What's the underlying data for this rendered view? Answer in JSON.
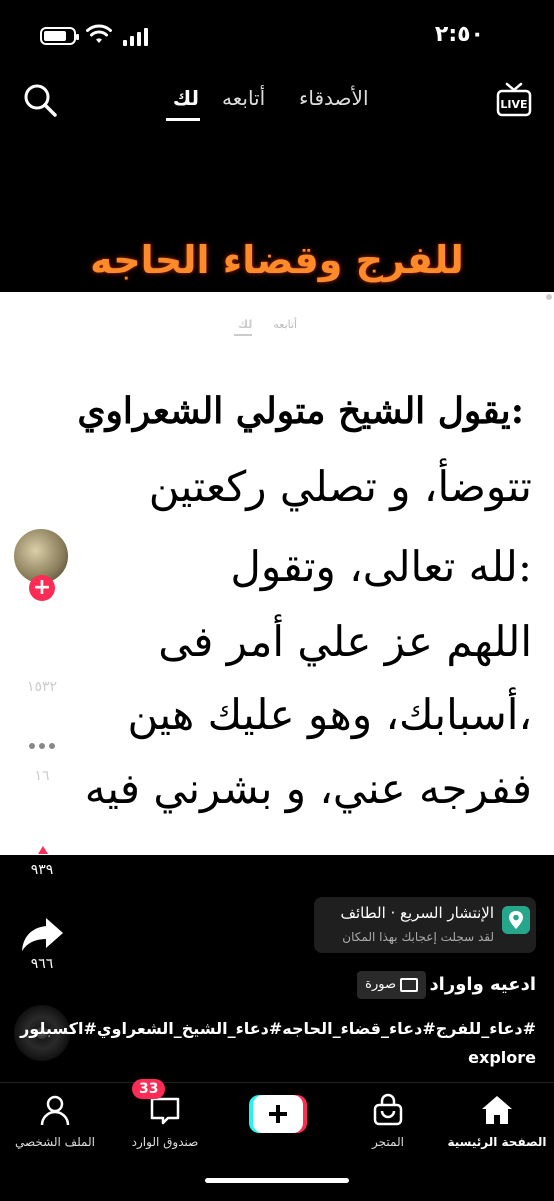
{
  "status": {
    "time": "٢:٥٠"
  },
  "topnav": {
    "tabs": [
      {
        "label": "لك",
        "active": true
      },
      {
        "label": "أتابعه"
      },
      {
        "label": "الأصدقاء"
      }
    ],
    "search_icon": "search-icon",
    "live_label": "LIVE"
  },
  "post": {
    "heading": "للفرج وقضاء الحاجه",
    "photo": {
      "tabs": [
        "أتابعه",
        "لك"
      ],
      "lines": [
        "يقول الشيخ متولي الشعراوي:",
        "تتوضأ، و تصلي ركعتين",
        "لله تعالى، وتقول:",
        "اللهم عز علي أمر فى",
        "أسبابك، وهو عليك هين،",
        "ففرجه عني، و بشرني فيه"
      ]
    },
    "likes": "١٥٣٢",
    "comments": "١٦",
    "saves": "٩٣٩",
    "shares": "٩٦٦",
    "location": {
      "title": "الإنتشار السريع · الطائف",
      "subtitle": "لقد سجلت إعجابك بهذا المكان"
    },
    "author": "ادعيه واوراد",
    "badge": "صورة",
    "caption": "#دعاء_للفرج#دعاء_قضاء_الحاجه#دعاء_الشيخ_الشعراوي#اكسبلور explore"
  },
  "bottomnav": {
    "items": [
      {
        "label": "الصفحة الرئيسية",
        "active": true
      },
      {
        "label": "المتجر"
      },
      {
        "label": "صندوق الوارد",
        "badge": "33"
      },
      {
        "label": "الملف الشخصي"
      }
    ]
  },
  "colors": {
    "accent": "#fe2c55",
    "heading": "#ff8a2a",
    "location_pin": "#26a68a"
  }
}
